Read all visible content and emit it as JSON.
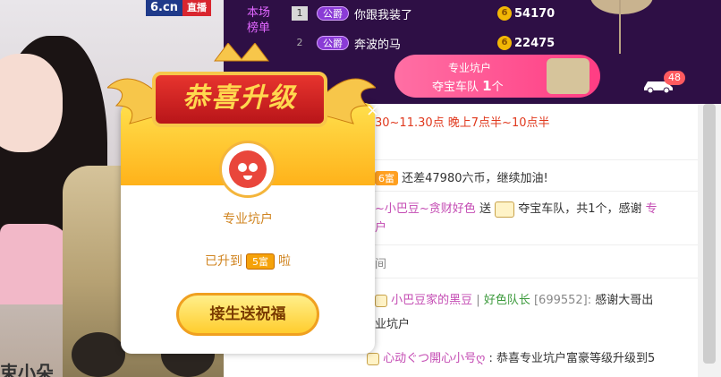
{
  "brand": {
    "site": "6.cn",
    "live": "直播"
  },
  "video": {
    "streamer_partial": "束小朵"
  },
  "ranking": {
    "label": "本场榜单",
    "rows": [
      {
        "rank": "1",
        "title": "公爵",
        "name": "你跟我装了",
        "coins": "54170"
      },
      {
        "rank": "2",
        "title": "公爵",
        "name": "奔波的马",
        "coins": "22475"
      }
    ]
  },
  "banner": {
    "line1": "专业坑户",
    "line2_prefix": "夺宝车队 ",
    "line2_count": "1",
    "line2_suffix": "个",
    "car_badge": "48"
  },
  "chat": {
    "schedule": "30~11.30点 晚上7点半~10点半",
    "line_rank": {
      "level": "6富",
      "text": "还差47980六币，继续加油!"
    },
    "line_gift_1": {
      "sender": "~小巴豆~贪财好色",
      "action": "送",
      "gift": "夺宝车队，共1个，感谢",
      "to": "专"
    },
    "line_gift_2": "户",
    "line_time": "间",
    "line_msg_1": {
      "sender": "小巴豆家的黑豆",
      "group": "好色队长",
      "id": "[699552]:",
      "text": "感谢大哥出"
    },
    "line_msg_1b": "业坑户",
    "line_msg_2": {
      "badge": "20.东12",
      "sender": "心动ぐつ開心小号ღ",
      "text": ":  恭喜专业坑户富豪等级升级到5"
    }
  },
  "popup": {
    "title": "恭喜升级",
    "username": "专业坑户",
    "upgrade_prefix": "已升到",
    "upgrade_level": "5富",
    "upgrade_suffix": "啦",
    "button": "接生送祝福",
    "close": "×"
  }
}
